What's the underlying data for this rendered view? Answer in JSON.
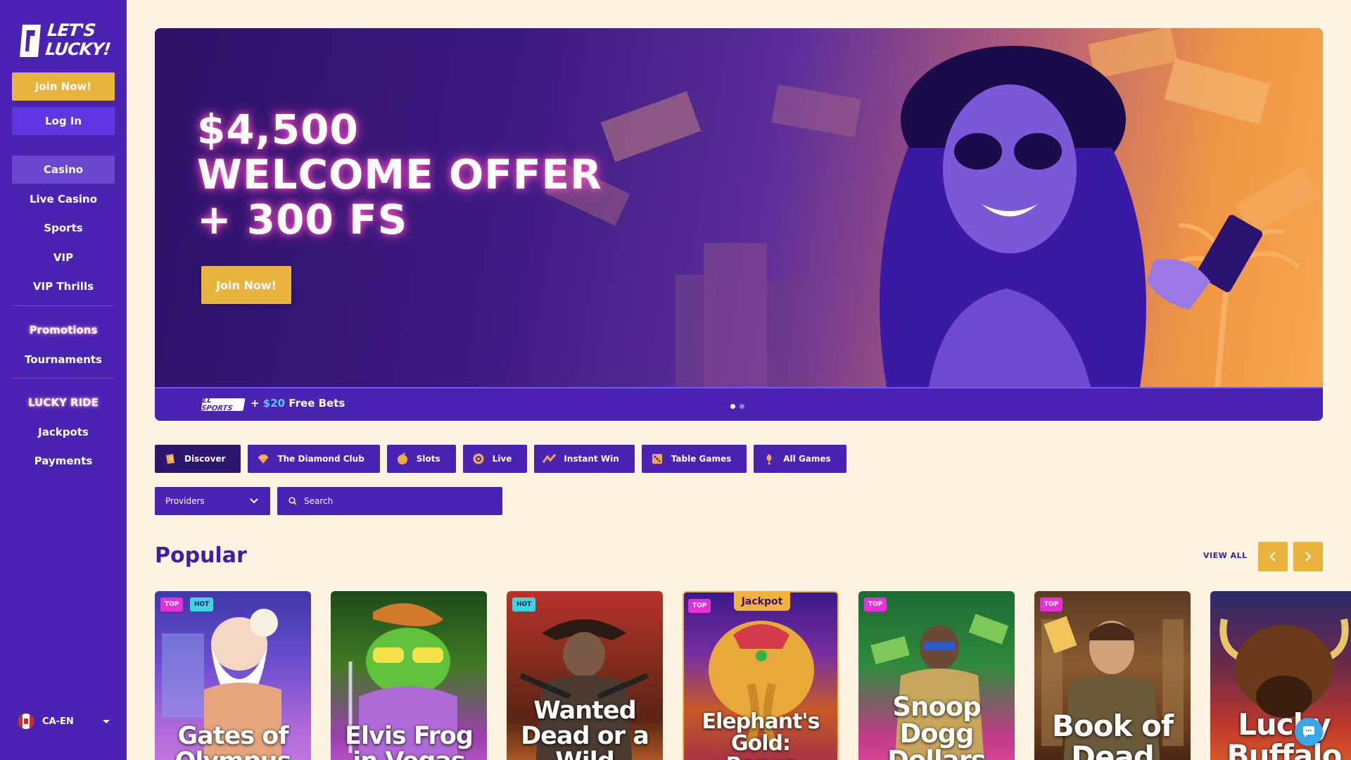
{
  "brand": {
    "logo_text_line1": "LET'S",
    "logo_text_line2": "LUCKY!"
  },
  "sidebar": {
    "join_label": "Join Now!",
    "login_label": "Log In",
    "nav": [
      {
        "label": "Casino",
        "active": true
      },
      {
        "label": "Live Casino"
      },
      {
        "label": "Sports"
      },
      {
        "label": "VIP"
      },
      {
        "label": "VIP Thrills"
      },
      {
        "label": "Promotions"
      },
      {
        "label": "Tournaments"
      },
      {
        "label": "LUCKY RIDE"
      },
      {
        "label": "Jackpots"
      },
      {
        "label": "Payments"
      }
    ],
    "language": "CA-EN"
  },
  "hero": {
    "line1": "$4,500",
    "line2": "WELCOME OFFER",
    "line3": "+ 300 FS",
    "cta": "Join Now!",
    "bar_logo": "LL SPORTS",
    "bar_prefix": "+ ",
    "bar_amount": "$20",
    "bar_suffix": " Free Bets",
    "slides": 2,
    "active_slide": 1
  },
  "categories": [
    {
      "label": "Discover",
      "icon": "discover-icon",
      "active": true
    },
    {
      "label": "The Diamond Club",
      "icon": "diamond-icon"
    },
    {
      "label": "Slots",
      "icon": "slots-icon"
    },
    {
      "label": "Live",
      "icon": "live-icon"
    },
    {
      "label": "Instant Win",
      "icon": "instant-win-icon"
    },
    {
      "label": "Table Games",
      "icon": "table-games-icon"
    },
    {
      "label": "All Games",
      "icon": "all-games-icon"
    }
  ],
  "filters": {
    "providers_label": "Providers",
    "search_placeholder": "Search"
  },
  "popular": {
    "title": "Popular",
    "view_all": "VIEW ALL",
    "games": [
      {
        "title_l1": "Gates of",
        "title_l2": "Olympus",
        "badges": [
          "TOP",
          "HOT"
        ]
      },
      {
        "title_l1": "Elvis Frog",
        "title_l2": "in Vegas",
        "badges": []
      },
      {
        "title_l1": "Wanted",
        "title_l2": "Dead or a",
        "title_l3": "Wild",
        "badges": [
          "HOT"
        ]
      },
      {
        "title_l1": "Elephant's",
        "title_l2": "Gold:",
        "title_l3": "Bonus Combo",
        "badges": [
          "TOP"
        ],
        "jackpot": "Jackpot"
      },
      {
        "title_l1": "Snoop",
        "title_l2": "Dogg",
        "title_l3": "Dollars",
        "badges": [
          "TOP"
        ]
      },
      {
        "title_l1": "Book of",
        "title_l2": "Dead",
        "badges": [
          "TOP"
        ]
      },
      {
        "title_l1": "Lucky",
        "title_l2": "Buffalo",
        "badges": []
      }
    ]
  },
  "colors": {
    "sidebar": "#4a23b3",
    "accent": "#e9b33e",
    "background": "#fdf3e3",
    "heading": "#3b1fa5"
  }
}
